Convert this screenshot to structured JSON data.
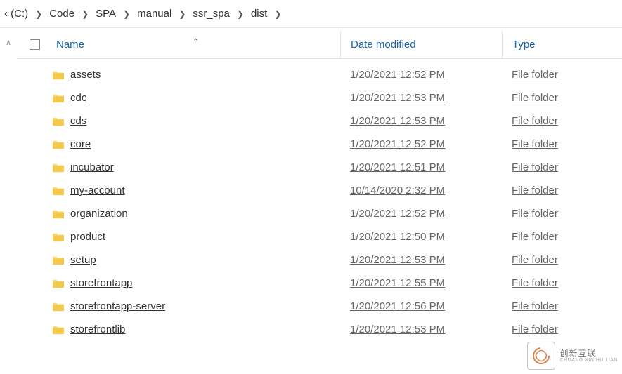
{
  "breadcrumb": [
    {
      "label": "‹ (C:)"
    },
    {
      "label": "Code"
    },
    {
      "label": "SPA"
    },
    {
      "label": "manual"
    },
    {
      "label": "ssr_spa"
    },
    {
      "label": "dist"
    }
  ],
  "columns": {
    "name": "Name",
    "date": "Date modified",
    "type": "Type"
  },
  "rows": [
    {
      "name": "assets",
      "date": "1/20/2021 12:52 PM",
      "type": "File folder"
    },
    {
      "name": "cdc",
      "date": "1/20/2021 12:53 PM",
      "type": "File folder"
    },
    {
      "name": "cds",
      "date": "1/20/2021 12:53 PM",
      "type": "File folder"
    },
    {
      "name": "core",
      "date": "1/20/2021 12:52 PM",
      "type": "File folder"
    },
    {
      "name": "incubator",
      "date": "1/20/2021 12:51 PM",
      "type": "File folder"
    },
    {
      "name": "my-account",
      "date": "10/14/2020 2:32 PM",
      "type": "File folder"
    },
    {
      "name": "organization",
      "date": "1/20/2021 12:52 PM",
      "type": "File folder"
    },
    {
      "name": "product",
      "date": "1/20/2021 12:50 PM",
      "type": "File folder"
    },
    {
      "name": "setup",
      "date": "1/20/2021 12:53 PM",
      "type": "File folder"
    },
    {
      "name": "storefrontapp",
      "date": "1/20/2021 12:55 PM",
      "type": "File folder"
    },
    {
      "name": "storefrontapp-server",
      "date": "1/20/2021 12:56 PM",
      "type": "File folder"
    },
    {
      "name": "storefrontlib",
      "date": "1/20/2021 12:53 PM",
      "type": "File folder"
    }
  ],
  "watermark": {
    "brand": "创新互联",
    "sub": "CHUANG XIN HU LIAN"
  }
}
